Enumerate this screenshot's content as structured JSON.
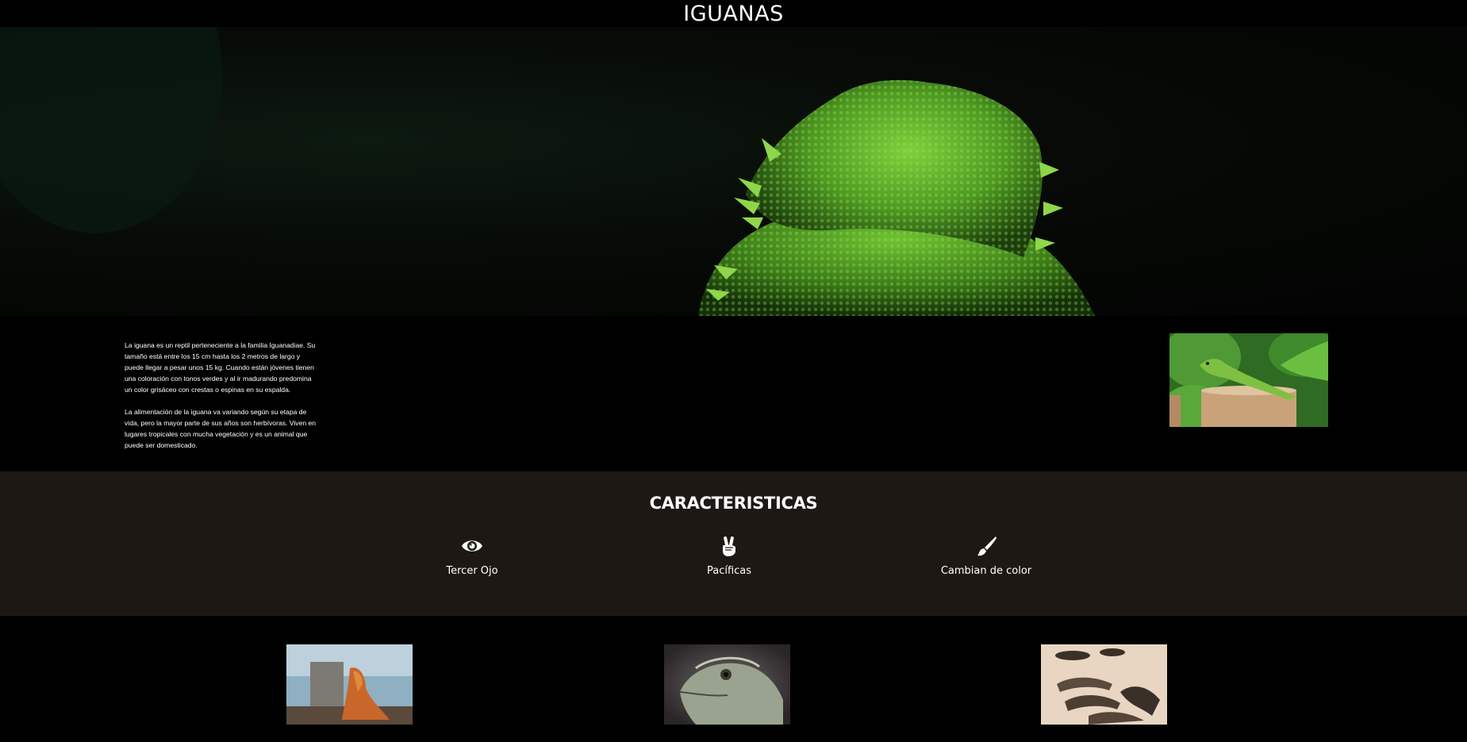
{
  "header": {
    "title": "IGUANAS"
  },
  "hero": {
    "image": "iguana-closeup-photo"
  },
  "intro": {
    "paragraph_1": "La iguana es un reptil perteneciente a la familia Iguanadiae. Su tamaño está entre los 15 cm hasta los 2 metros de largo y puede llegar a pesar unos 15 kg. Cuando están jóvenes tienen una coloración con tonos verdes y al ir madurando predomina un color grisáceo con crestas o espinas en su espalda.",
    "paragraph_2": "La alimentación de la iguana va variando según su etapa de vida, pero la mayor parte de sus años son herbívoras. Viven en lugares tropicales con mucha vegetación y es un animal que puede ser domesticado.",
    "photo": "green-iguana-on-stump-photo"
  },
  "features": {
    "title": "CARACTERISTICAS",
    "items": [
      {
        "label": "Tercer Ojo",
        "icon": "eye-icon"
      },
      {
        "label": "Pacíficas",
        "icon": "peace-hand-icon"
      },
      {
        "label": "Cambian de color",
        "icon": "paint-brush-icon"
      }
    ]
  },
  "gallery": {
    "images": [
      "iguana-on-beach-photo",
      "iguana-head-portrait-photo",
      "iguanas-on-sand-photo"
    ]
  }
}
